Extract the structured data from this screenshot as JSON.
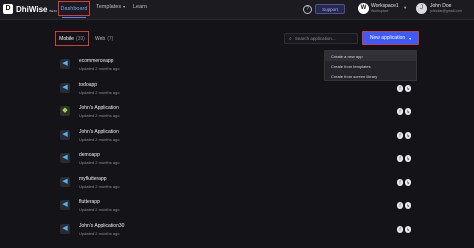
{
  "header": {
    "logo_mark": "D",
    "logo_text": "DhiWise",
    "logo_beta": "BETA",
    "nav": [
      {
        "label": "Dashboard"
      },
      {
        "label": "Templates"
      },
      {
        "label": "Learn"
      }
    ],
    "help_glyph": "?",
    "support_label": "Support",
    "workspace_initial": "W",
    "workspace_name": "Workspace1",
    "workspace_sub": "Workspace",
    "user_initial": "J",
    "user_name": "John Doe",
    "user_email": "johndoe@gmail.com"
  },
  "tabs": {
    "mobile_label": "Mobile",
    "mobile_count": "(39)",
    "web_label": "Web",
    "web_count": "(7)"
  },
  "search": {
    "placeholder": "Search application..."
  },
  "new_app_button": "New application",
  "dropdown": {
    "items": [
      "Create a new app",
      "Create from templates",
      "Create from screen library"
    ]
  },
  "apps": [
    {
      "name": "ecommerceapp",
      "updated": "Updated 2 months ago",
      "icon": "flutter"
    },
    {
      "name": "todoapp",
      "updated": "Updated 2 months ago",
      "icon": "flutter"
    },
    {
      "name": "John's Application",
      "updated": "Updated 2 months ago",
      "icon": "android"
    },
    {
      "name": "John's Application",
      "updated": "Updated 2 months ago",
      "icon": "flutter"
    },
    {
      "name": "demoapp",
      "updated": "Updated 2 months ago",
      "icon": "flutter"
    },
    {
      "name": "myflutterapp",
      "updated": "Updated 2 months ago",
      "icon": "flutter"
    },
    {
      "name": "flutterapp",
      "updated": "Updated 2 months ago",
      "icon": "flutter"
    },
    {
      "name": "John's Application30",
      "updated": "Updated 2 months ago",
      "icon": "flutter"
    }
  ],
  "badges": {
    "lang": "f",
    "link": "↳"
  },
  "colors": {
    "accent": "#3d5afe",
    "highlight_border": "#d43b3b",
    "background": "#141418"
  }
}
